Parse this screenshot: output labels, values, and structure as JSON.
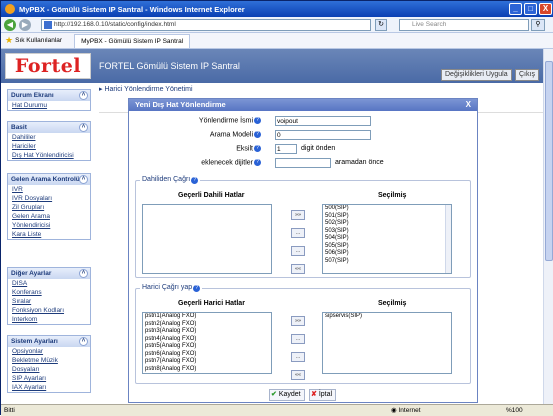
{
  "window": {
    "title": "MyPBX - Gömülü Sistem IP Santral - Windows Internet Explorer",
    "minimize": "_",
    "maximize": "□",
    "close": "X"
  },
  "browser": {
    "address": "http://192.168.0.10/static/config/index.html",
    "search_placeholder": "Live Search",
    "favorites_label": "Sık Kullanılanlar",
    "tab_label": "MyPBX - Gömülü Sistem IP Santral",
    "status_text": "Bitti",
    "zone_text": "Internet",
    "zoom_text": "%100"
  },
  "app": {
    "logo": "Fortel",
    "title": "FORTEL Gömülü Sistem IP Santral",
    "apply_button": "Değişiklikleri Uygula",
    "exit_button": "Çıkış",
    "section_title": "Harici Yönlendirme Yönetimi"
  },
  "sidebar": {
    "groups": [
      {
        "title": "Durum Ekranı",
        "items": [
          "Hat Durumu"
        ]
      },
      {
        "title": "Basit",
        "items": [
          "Dahililer",
          "Hariciler",
          "Dış Hat Yönlendiricisi"
        ]
      },
      {
        "title": "Gelen Arama Kontrolü",
        "items": [
          "IVR",
          "IVR Dosyaları",
          "Zil Grupları",
          "Gelen Arama",
          "Yönlendiricisi",
          "Kara Liste"
        ]
      },
      {
        "title": "Diğer Ayarlar",
        "items": [
          "DISA",
          "Konferans",
          "Sıralar",
          "Fonksiyon Kodları",
          "Interkom"
        ]
      },
      {
        "title": "Sistem Ayarları",
        "items": [
          "Opsiyonlar",
          "Bekletme Müzik",
          "Dosyaları",
          "SIP Ayarları",
          "IAX Ayarları"
        ]
      }
    ]
  },
  "modal": {
    "title": "Yeni Dış Hat Yönlendirme",
    "close": "X",
    "fields": {
      "name_label": "Yönlendirme İsmi",
      "name_value": "voipout",
      "pattern_label": "Arama Modeli",
      "pattern_value": "0",
      "strip_label": "Eksilt",
      "strip_value": "1",
      "strip_suffix": "digit önden",
      "prepend_label": "eklenecek dijitler",
      "prepend_value": "",
      "prepend_suffix": "aramadan önce"
    },
    "internal": {
      "legend": "Dahiliden Çağrı",
      "available_header": "Geçerli Dahili Hatlar",
      "selected_header": "Seçilmiş",
      "available": [],
      "selected": [
        "500(SIP)",
        "501(SIP)",
        "502(SIP)",
        "503(SIP)",
        "504(SIP)",
        "505(SIP)",
        "506(SIP)",
        "507(SIP)"
      ]
    },
    "external": {
      "legend": "Harici Çağrı yap",
      "available_header": "Geçerli Harici Hatlar",
      "selected_header": "Seçilmiş",
      "available": [
        "pstn1(Analog FXO)",
        "pstn2(Analog FXO)",
        "pstn3(Analog FXO)",
        "pstn4(Analog FXO)",
        "pstn5(Analog FXO)",
        "pstn6(Analog FXO)",
        "pstn7(Analog FXO)",
        "pstn8(Analog FXO)"
      ],
      "selected": [
        "sipservis(SIP)"
      ]
    },
    "move_all_right": "»»",
    "move_right": "...",
    "move_left": "...",
    "move_all_left": "««",
    "save_button": "Kaydet",
    "cancel_button": "İptal"
  }
}
